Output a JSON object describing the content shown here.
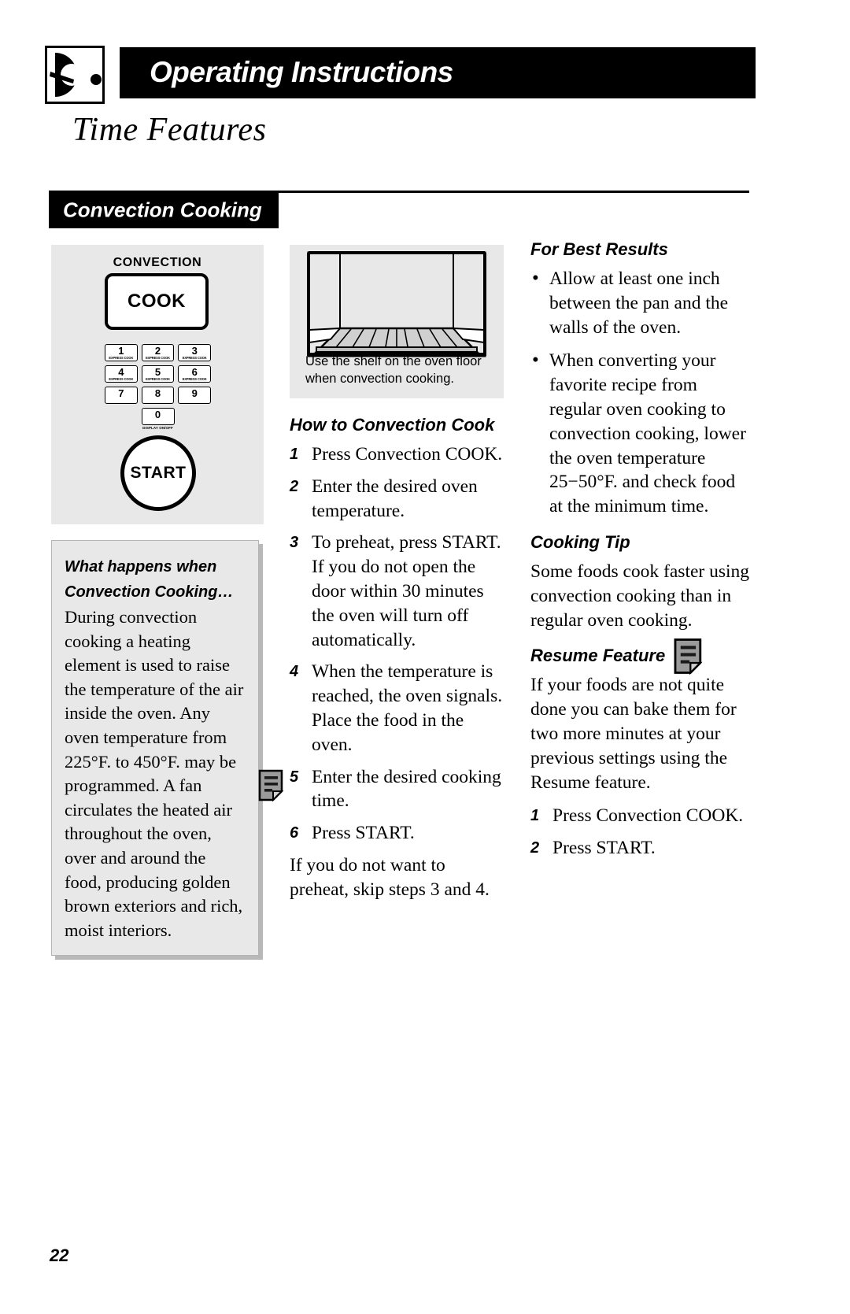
{
  "header": {
    "logo_icon": "oven-knob-icon",
    "title": "Operating Instructions",
    "subject": "Time Features"
  },
  "section": {
    "tab_label": "Convection Cooking"
  },
  "control_panel": {
    "convection_label": "CONVECTION",
    "cook_key": "COOK",
    "start_key": "START",
    "keys": [
      {
        "num": "1",
        "sub": "EXPRESS COOK"
      },
      {
        "num": "2",
        "sub": "EXPRESS COOK"
      },
      {
        "num": "3",
        "sub": "EXPRESS COOK"
      },
      {
        "num": "4",
        "sub": "EXPRESS COOK"
      },
      {
        "num": "5",
        "sub": "EXPRESS COOK"
      },
      {
        "num": "6",
        "sub": "EXPRESS COOK"
      },
      {
        "num": "7",
        "sub": ""
      },
      {
        "num": "8",
        "sub": ""
      },
      {
        "num": "9",
        "sub": ""
      }
    ],
    "zero_key": "0",
    "zero_sub": "DISPLAY ON/OFF"
  },
  "info_box": {
    "title_line1": "What happens when",
    "title_line2": "Convection Cooking…",
    "body": "During convection cooking a heating element is used to raise the temperature of the air inside the oven. Any oven temperature from 225°F. to 450°F. may be programmed. A fan circulates the heated air throughout the oven, over and around the food, producing golden brown exteriors and rich, moist interiors."
  },
  "oven_figure": {
    "icon": "oven-interior-shelf-illustration",
    "caption": "Use the shelf on the oven floor when convection cooking."
  },
  "how_to": {
    "heading": "How to Convection Cook",
    "steps": [
      {
        "num": "1",
        "text": "Press Convection COOK."
      },
      {
        "num": "2",
        "text": "Enter the desired oven temperature."
      },
      {
        "num": "3",
        "text": "To preheat, press START. If you do not open the door within 30 minutes the oven will turn off automatically."
      },
      {
        "num": "4",
        "text": "When the temperature is reached, the oven signals. Place the food in the oven."
      },
      {
        "num": "5",
        "text": "Enter the desired cooking time.",
        "note_icon": "note-page-icon"
      },
      {
        "num": "6",
        "text": "Press START."
      }
    ],
    "closing": "If you do not want to preheat, skip steps 3 and 4."
  },
  "best_results": {
    "heading": "For Best Results",
    "bullets": [
      "Allow at least one inch between the pan and the walls of the oven.",
      "When converting your favorite recipe from regular oven cooking to convection cooking, lower the oven temperature 25−50°F. and check food at the minimum time."
    ]
  },
  "cooking_tip": {
    "heading": "Cooking Tip",
    "body": "Some foods cook faster using convection cooking than in regular oven cooking."
  },
  "resume_feature": {
    "heading": "Resume Feature",
    "note_icon": "note-page-icon",
    "body": "If your foods are not quite done you can bake them for two more minutes at your previous settings using the Resume feature.",
    "steps": [
      {
        "num": "1",
        "text": "Press Convection COOK."
      },
      {
        "num": "2",
        "text": "Press START."
      }
    ]
  },
  "footer": {
    "page_number": "22"
  },
  "colors": {
    "ink": "#000000",
    "paper": "#ffffff",
    "panel_gray": "#e8e8e8",
    "note_icon_gray": "#8c8c8c",
    "box_border": "#b4b4b4"
  }
}
